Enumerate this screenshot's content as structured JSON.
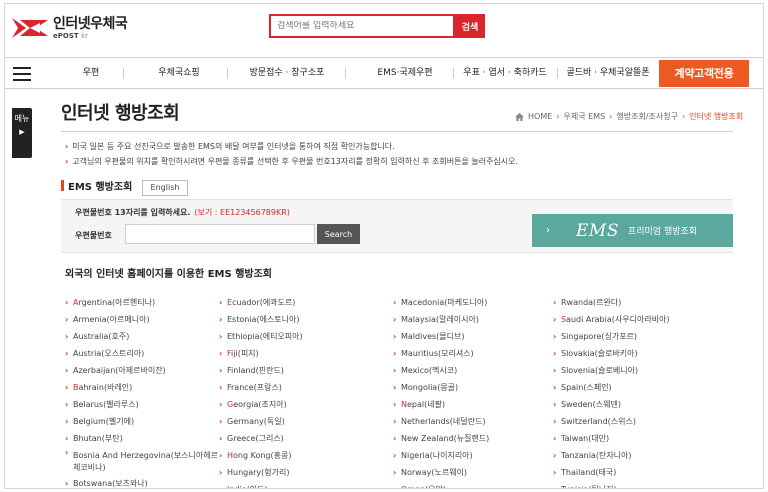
{
  "header": {
    "logo_main": "인터넷우체국",
    "logo_sub_brand": "ePOST",
    "logo_sub_tld": "kr",
    "search_placeholder": "검색어를 입력하세요",
    "search_button": "검색"
  },
  "nav": {
    "items": [
      "우편",
      "우체국쇼핑",
      "방문접수 · 창구소포",
      "EMS·국제우편",
      "우표 · 엽서 · 축하카드",
      "골드바 · 우체국알뜰폰"
    ],
    "special": "계약고객전용",
    "side_tab_label": "메뉴",
    "side_tab_arrow": "▶"
  },
  "page": {
    "title": "인터넷 행방조회",
    "breadcrumb": [
      "HOME",
      "우체국 EMS",
      "행방조회/조사청구",
      "인터넷 행방조회"
    ],
    "notes": [
      "미국 일본 등 주요 선진국으로 발송한 EMS의 배달 여부를 인터넷을 통하여 직접 확인가능합니다.",
      "고객님의 우편물의 위치를 확인하시려면 우편물 종류를 선택한 후 우편물 번호13자리를 정확히 입력하신 후 조회버튼을 눌러주십시오."
    ]
  },
  "ems": {
    "section_title": "EMS 행방조회",
    "english_button": "English",
    "instruction": "우편물번호 13자리를 입력하세요.",
    "example": "(보기 : EE123456789KR)",
    "track_label": "우편물번호",
    "search_button": "Search",
    "premium_chevron": "›",
    "premium_brand": "EMS",
    "premium_label": "프리미엄 행방조회"
  },
  "foreign": {
    "title": "외국의 인터넷 홈페이지를 이용한 EMS 행방조회",
    "columns": [
      [
        {
          "first": "A",
          "rest": "rgentina(아르헨티나)"
        },
        {
          "first": "",
          "rest": "Armenia(아르메니아)"
        },
        {
          "first": "",
          "rest": "Australia(호주)"
        },
        {
          "first": "",
          "rest": "Austria(오스트리아)"
        },
        {
          "first": "",
          "rest": "Azerbaijan(아제르바이잔)"
        },
        {
          "first": "B",
          "rest": "ahrain(바레인)"
        },
        {
          "first": "",
          "rest": "Belarus(벨라루스)"
        },
        {
          "first": "",
          "rest": "Belgium(벨기에)"
        },
        {
          "first": "",
          "rest": "Bhutan(부탄)"
        },
        {
          "first": "",
          "rest": "Bosnia And Herzegovina(보스니아헤르체코비나)",
          "two": true
        },
        {
          "first": "",
          "rest": "Botswana(보츠와나)"
        }
      ],
      [
        {
          "first": "E",
          "rest": "cuador(에콰도르)"
        },
        {
          "first": "",
          "rest": "Estonia(에스토니아)"
        },
        {
          "first": "",
          "rest": "Ethiopia(에티오피아)"
        },
        {
          "first": "F",
          "rest": "iji(피지)"
        },
        {
          "first": "",
          "rest": "Finland(핀란드)"
        },
        {
          "first": "",
          "rest": "France(프랑스)"
        },
        {
          "first": "G",
          "rest": "eorgia(조지아)"
        },
        {
          "first": "",
          "rest": "Germany(독일)"
        },
        {
          "first": "",
          "rest": "Greece(그리스)"
        },
        {
          "first": "H",
          "rest": "ong Kong(홍콩)"
        },
        {
          "first": "",
          "rest": "Hungary(헝가리)"
        },
        {
          "first": "I",
          "rest": "ndia(인도)"
        }
      ],
      [
        {
          "first": "",
          "rest": "Macedonia(마케도니아)"
        },
        {
          "first": "",
          "rest": "Malaysia(말레이시아)"
        },
        {
          "first": "",
          "rest": "Maldives(몰디브)"
        },
        {
          "first": "",
          "rest": "Mauritius(모리셔스)"
        },
        {
          "first": "",
          "rest": "Mexico(멕시코)"
        },
        {
          "first": "",
          "rest": "Mongolia(몽골)"
        },
        {
          "first": "N",
          "rest": "epal(네팔)"
        },
        {
          "first": "",
          "rest": "Netherlands(네덜란드)"
        },
        {
          "first": "",
          "rest": "New Zealand(뉴질랜드)"
        },
        {
          "first": "",
          "rest": "Nigeria(나이지리아)"
        },
        {
          "first": "",
          "rest": "Norway(노르웨이)"
        },
        {
          "first": "O",
          "rest": "man(오만)"
        }
      ],
      [
        {
          "first": "",
          "rest": "Rwanda(르완다)"
        },
        {
          "first": "S",
          "rest": "audi Arabia(사우디아라비아)"
        },
        {
          "first": "",
          "rest": "Singapore(싱가포르)"
        },
        {
          "first": "",
          "rest": "Slovakia(슬로바키아)"
        },
        {
          "first": "",
          "rest": "Slovenia(슬로베니아)"
        },
        {
          "first": "",
          "rest": "Spain(스페인)"
        },
        {
          "first": "",
          "rest": "Sweden(스웨덴)"
        },
        {
          "first": "",
          "rest": "Switzerland(스위스)"
        },
        {
          "first": "T",
          "rest": "aiwan(대만)"
        },
        {
          "first": "",
          "rest": "Tanzania(탄자니아)"
        },
        {
          "first": "",
          "rest": "Thailand(태국)"
        },
        {
          "first": "",
          "rest": "Tunisia(튀니지)"
        }
      ]
    ]
  },
  "colors": {
    "brand_red": "#d9262c",
    "accent_orange": "#ec5a24",
    "premium_teal": "#5ba89e"
  },
  "icons": [
    "epost-logo-icon",
    "hamburger-icon",
    "home-icon",
    "chevron-right-icon"
  ]
}
